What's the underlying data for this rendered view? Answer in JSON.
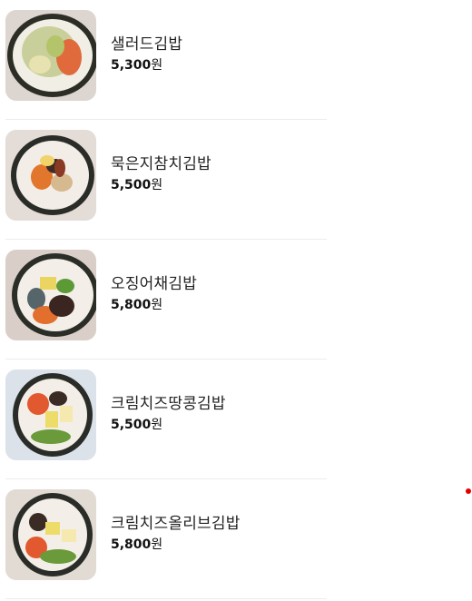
{
  "menu": {
    "items": [
      {
        "name": "샐러드김밥",
        "price": "5,300",
        "currency": "원",
        "image_icon": "salad-gimbap-photo"
      },
      {
        "name": "묵은지참치김밥",
        "price": "5,500",
        "currency": "원",
        "image_icon": "kimchi-tuna-gimbap-photo"
      },
      {
        "name": "오징어채김밥",
        "price": "5,800",
        "currency": "원",
        "image_icon": "squid-gimbap-photo"
      },
      {
        "name": "크림치즈땅콩김밥",
        "price": "5,500",
        "currency": "원",
        "image_icon": "cream-cheese-peanut-gimbap-photo"
      },
      {
        "name": "크림치즈올리브김밥",
        "price": "5,800",
        "currency": "원",
        "image_icon": "cream-cheese-olive-gimbap-photo"
      }
    ]
  },
  "colors": {
    "indicator": "#e00000"
  }
}
